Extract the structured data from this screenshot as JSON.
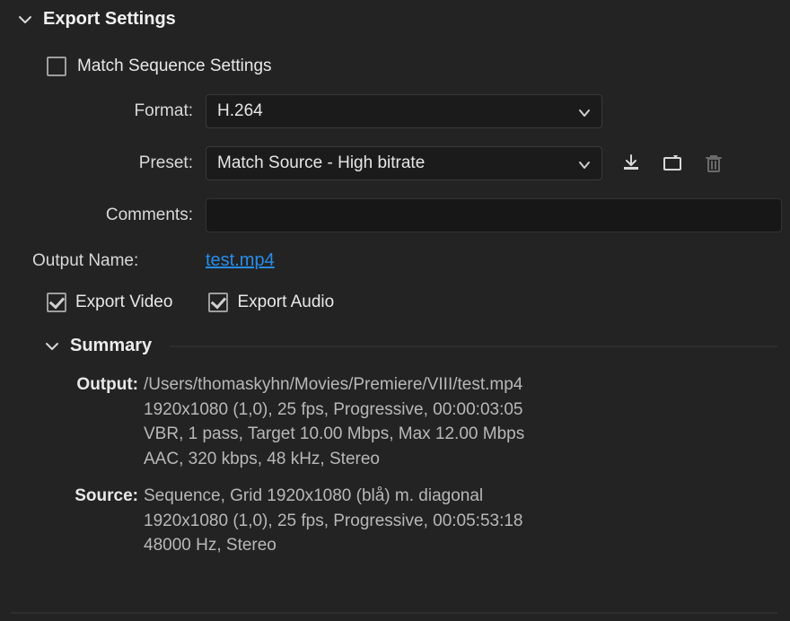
{
  "exportSettings": {
    "title": "Export Settings",
    "matchSequence": {
      "label": "Match Sequence Settings",
      "checked": false
    },
    "format": {
      "label": "Format:",
      "value": "H.264"
    },
    "preset": {
      "label": "Preset:",
      "value": "Match Source - High bitrate"
    },
    "comments": {
      "label": "Comments:",
      "value": ""
    },
    "outputName": {
      "label": "Output Name:",
      "value": "test.mp4"
    },
    "exportVideo": {
      "label": "Export Video",
      "checked": true
    },
    "exportAudio": {
      "label": "Export Audio",
      "checked": true
    },
    "icons": {
      "savePreset": "save-preset-icon",
      "importPreset": "import-preset-icon",
      "deletePreset": "delete-preset-icon"
    }
  },
  "summary": {
    "title": "Summary",
    "output": {
      "key": "Output:",
      "text": "/Users/thomaskyhn/Movies/Premiere/VIII/test.mp4\n1920x1080 (1,0), 25 fps, Progressive, 00:00:03:05\nVBR, 1 pass, Target 10.00 Mbps, Max 12.00 Mbps\nAAC, 320 kbps, 48 kHz, Stereo"
    },
    "source": {
      "key": "Source:",
      "text": "Sequence, Grid 1920x1080 (blå) m. diagonal\n1920x1080 (1,0), 25 fps, Progressive, 00:05:53:18\n48000 Hz, Stereo"
    }
  },
  "colors": {
    "link": "#288ce8",
    "panelBg": "#232323",
    "ddBg": "#1b1b1b"
  }
}
